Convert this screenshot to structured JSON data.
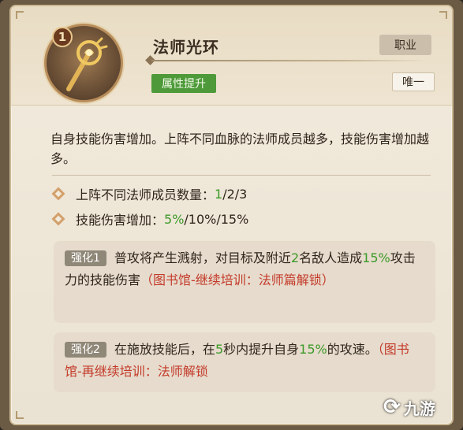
{
  "skill": {
    "badge_number": "1",
    "name": "法师光环",
    "type_tag": "属性提升",
    "category_tag": "职业",
    "rarity_tag": "唯一",
    "icon": "golden-staff-icon"
  },
  "description": "自身技能伤害增加。上阵不同血脉的法师成员越多，技能伤害增加越多。",
  "stats": [
    {
      "label": "上阵不同法师成员数量：",
      "value_highlight": "1",
      "value_rest": "/2/3"
    },
    {
      "label": "技能伤害增加：",
      "value_highlight": "5%",
      "value_rest": "/10%/15%"
    }
  ],
  "enhancements": [
    {
      "tag": "强化1",
      "text_a": "普攻将产生溅射，对目标及附近",
      "num_a": "2",
      "text_b": "名敌人造成",
      "num_b": "15%",
      "text_c": "攻击力的技能伤害",
      "unlock": "（图书馆-继续培训：法师篇解锁）"
    },
    {
      "tag": "强化2",
      "text_a": "在施放技能后，在",
      "num_a": "5",
      "text_b": "秒内提升自身",
      "num_b": "15%",
      "text_c": "的攻速。",
      "unlock": "（图书馆-再继续培训：法师解锁"
    }
  ],
  "watermark": "九游",
  "colors": {
    "highlight": "#3d9a2a",
    "unlock": "#c43a2a",
    "tag_green": "#4e9a3a"
  }
}
